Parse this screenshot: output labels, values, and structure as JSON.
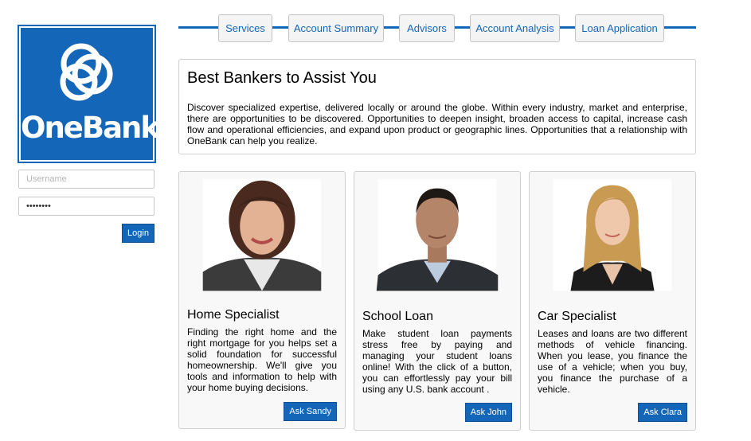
{
  "brand": {
    "name": "OneBank",
    "logo_icon": "interlocking-rings-icon",
    "color": "#1467b8"
  },
  "login": {
    "username_placeholder": "Username",
    "password_value": "password",
    "button_label": "Login"
  },
  "nav": {
    "tabs": [
      {
        "label": "Services"
      },
      {
        "label": "Account Summary"
      },
      {
        "label": "Advisors"
      },
      {
        "label": "Account Analysis"
      },
      {
        "label": "Loan Application"
      }
    ]
  },
  "intro": {
    "title": "Best Bankers to Assist You",
    "body": "Discover specialized expertise, delivered locally or around the globe. Within every industry, market and enterprise, there are opportunities to be discovered. Opportunities to deepen insight, broaden access to capital, increase cash flow and operational efficiencies, and expand upon product or geographic lines. Opportunities that a relationship with OneBank can help you realize."
  },
  "cards": [
    {
      "title": "Home Specialist",
      "body": "Finding the right home and the right mortgage for you helps set a solid foundation for successful homeownership. We'll give you tools and information to help with your home buying decisions.",
      "button": "Ask Sandy",
      "photo": "banker-photo"
    },
    {
      "title": "School Loan",
      "body": "Make student loan payments stress free by paying and managing your student loans online! With the click of a button, you can effortlessly pay your bill using any U.S. bank account .",
      "button": "Ask John",
      "photo": "banker-photo"
    },
    {
      "title": "Car Specialist",
      "body": "Leases and loans are two different methods of vehicle financing. When you lease, you finance the use of a vehicle; when you buy, you finance the purchase of a vehicle.",
      "button": "Ask Clara",
      "photo": "banker-photo"
    }
  ]
}
